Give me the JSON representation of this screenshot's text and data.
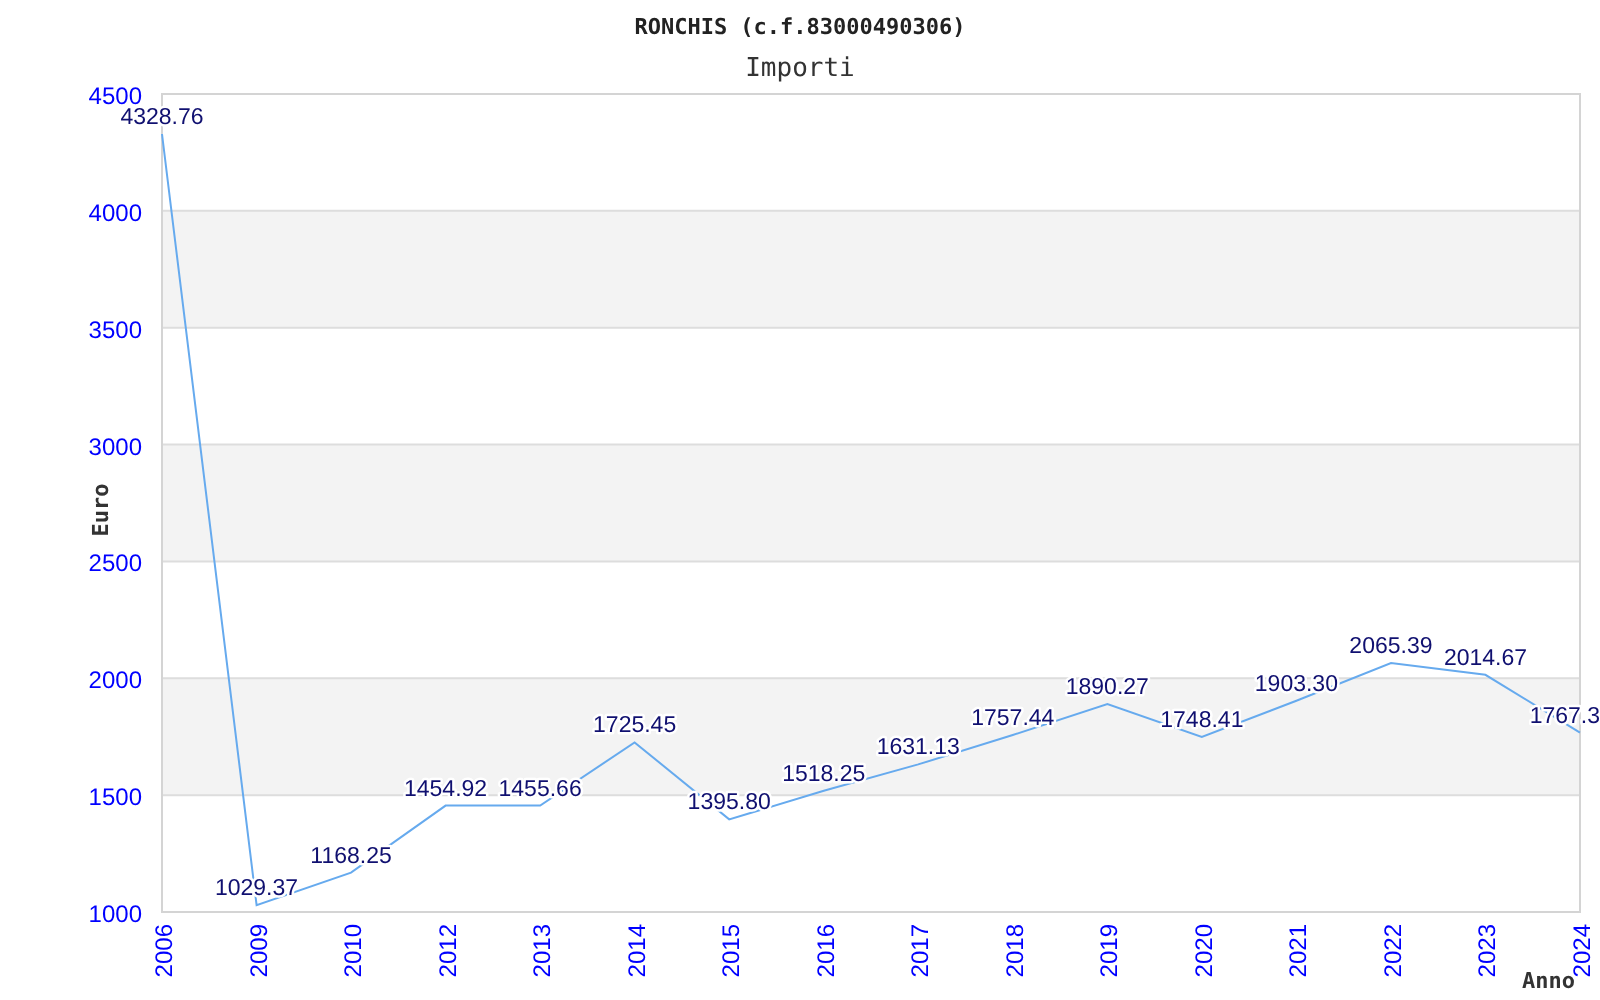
{
  "heading": "RONCHIS (c.f.83000490306)",
  "chart_data": {
    "type": "line",
    "title": "Importi",
    "xlabel": "Anno",
    "ylabel": "Euro",
    "categories": [
      "2006",
      "2009",
      "2010",
      "2012",
      "2013",
      "2014",
      "2015",
      "2016",
      "2017",
      "2018",
      "2019",
      "2020",
      "2021",
      "2022",
      "2023",
      "2024"
    ],
    "grid": true,
    "series": [
      {
        "color": "#66aaee",
        "values": [
          4328.76,
          1029.37,
          1168.25,
          1454.92,
          1455.66,
          1725.45,
          1395.8,
          1518.25,
          1631.13,
          1757.44,
          1890.27,
          1748.41,
          1903.3,
          2065.39,
          2014.67,
          1767.3
        ]
      }
    ],
    "value_labels": [
      "4328.76",
      "1029.37",
      "1168.25",
      "1454.92",
      "1455.66",
      "1725.45",
      "1395.80",
      "1518.25",
      "1631.13",
      "1757.44",
      "1890.27",
      "1748.41",
      "1903.30",
      "2065.39",
      "2014.67",
      "1767.3"
    ],
    "ylim": [
      1000,
      4500
    ],
    "yticks": [
      1000,
      1500,
      2000,
      2500,
      3000,
      3500,
      4000,
      4500
    ]
  }
}
